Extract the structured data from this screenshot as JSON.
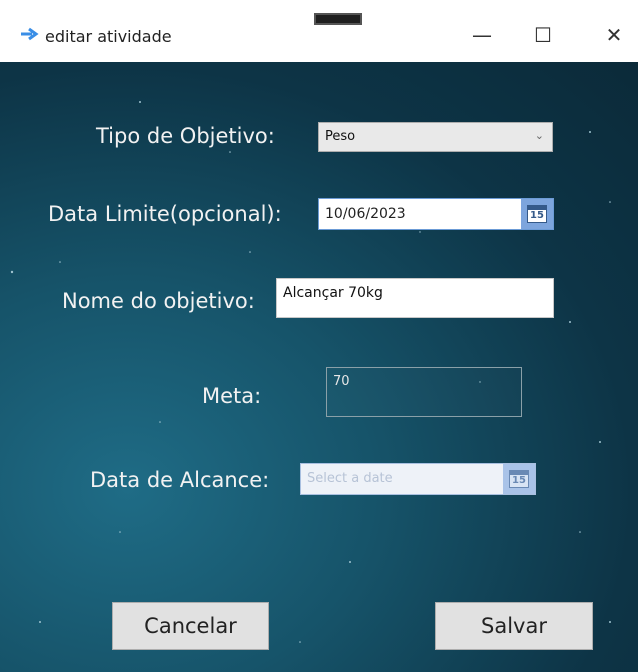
{
  "window": {
    "title": "editar atividade",
    "controls": {
      "minimize": "—",
      "maximize": "☐",
      "close": "✕"
    }
  },
  "form": {
    "tipo_label": "Tipo de Objetivo:",
    "tipo_value": "Peso",
    "data_limite_label": "Data Limite(opcional):",
    "data_limite_value": "10/06/2023",
    "nome_label": "Nome do objetivo:",
    "nome_value": "Alcançar 70kg",
    "meta_label": "Meta:",
    "meta_value": "70",
    "data_alcance_label": "Data de Alcance:",
    "data_alcance_placeholder": "Select a date",
    "calendar_day": "15"
  },
  "buttons": {
    "cancelar": "Cancelar",
    "salvar": "Salvar"
  },
  "colors": {
    "background": "#165369",
    "datepicker_accent": "#7da5dd"
  },
  "icons": {
    "app": "arrow-app-icon",
    "dropdown": "chevron-down-icon",
    "calendar": "calendar-icon"
  }
}
